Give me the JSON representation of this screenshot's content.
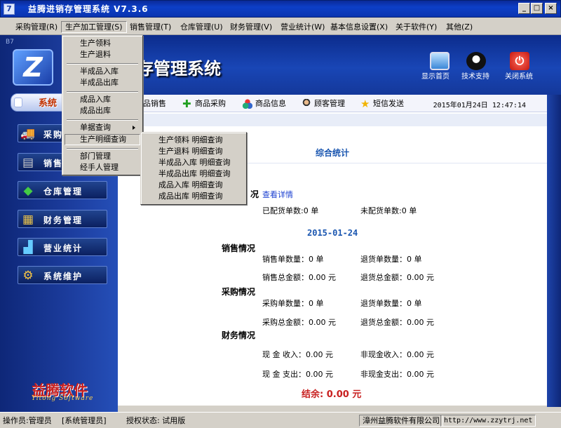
{
  "window": {
    "title": "益腾进销存管理系统  V7.3.6",
    "minimize_icon": "minimize-icon",
    "maximize_icon": "maximize-icon",
    "close_icon": "close-icon"
  },
  "menubar": {
    "items": [
      {
        "label": "采购管理(R)"
      },
      {
        "label": "生产加工管理(S)"
      },
      {
        "label": "销售管理(T)"
      },
      {
        "label": "仓库管理(U)"
      },
      {
        "label": "财务管理(V)"
      },
      {
        "label": "营业统计(W)"
      },
      {
        "label": "基本信息设置(X)"
      },
      {
        "label": "关于软件(Y)"
      },
      {
        "label": "其他(Z)"
      }
    ],
    "active_index": 1
  },
  "production_menu": {
    "items": [
      "生产领料",
      "生产退料",
      "半成品入库",
      "半成品出库",
      "成品入库",
      "成品出库",
      "单据查询",
      "生产明细查询",
      "部门管理",
      "经手人管理"
    ],
    "highlighted": "生产明细查询"
  },
  "detail_submenu": {
    "items": [
      "生产领料  明细查询",
      "生产退料  明细查询",
      "半成品入库  明细查询",
      "半成品出库  明细查询",
      "成品入库  明细查询",
      "成品出库  明细查询"
    ]
  },
  "banner": {
    "corner_code": "B7",
    "title_visible": "存管理系统",
    "buttons": [
      {
        "label": "显示首页",
        "icon": "monitor-icon"
      },
      {
        "label": "技术支持",
        "icon": "qq-penguin-icon"
      },
      {
        "label": "关闭系统",
        "icon": "power-icon"
      }
    ]
  },
  "nav_tab": {
    "label": "系统"
  },
  "toolbar": {
    "items": [
      {
        "label": "品销售",
        "icon": ""
      },
      {
        "label": "商品采购",
        "icon": "green-plus-icon"
      },
      {
        "label": "商品信息",
        "icon": "colored-balls-icon"
      },
      {
        "label": "顾客管理",
        "icon": "people-icon"
      },
      {
        "label": "短信发送",
        "icon": "star-icon"
      }
    ],
    "datetime": "2015年01月24日  12:47:14"
  },
  "sidebar": {
    "items": [
      {
        "label": "采购",
        "icon": "purchase-truck-icon"
      },
      {
        "label": "销售",
        "icon": "cash-register-icon"
      },
      {
        "label": "仓库管理",
        "icon": "warehouse-boxes-icon"
      },
      {
        "label": "财务管理",
        "icon": "money-icon"
      },
      {
        "label": "营业统计",
        "icon": "statistics-icon"
      },
      {
        "label": "系统维护",
        "icon": "gear-icon"
      }
    ],
    "brand": "益腾软件",
    "brand_sub": "Yitong Software"
  },
  "content": {
    "section_title": "综合统计",
    "delivery": {
      "heading_visible": "况",
      "link": "查看详情",
      "delivered": "已配货单数:0 单",
      "undelivered": "未配货单数:0 单"
    },
    "date": "2015-01-24",
    "sales": {
      "heading": "销售情况",
      "count": "销售单数量：0 单",
      "return_count": "退货单数量：0 单",
      "total": "销售总金额：0.00 元",
      "return_total": "退货总金额：0.00 元"
    },
    "purchase": {
      "heading": "采购情况",
      "count": "采购单数量：0 单",
      "return_count": "退货单数量：0 单",
      "total": "采购总金额：0.00 元",
      "return_total": "退货总金额：0.00 元"
    },
    "finance": {
      "heading": "财务情况",
      "cash_in": "现 金 收入：0.00 元",
      "noncash_in": "非现金收入：0.00 元",
      "cash_out": "现 金 支出：0.00 元",
      "noncash_out": "非现金支出：0.00 元"
    },
    "balance": "结余: 0.00 元"
  },
  "statusbar": {
    "operator": "操作员:管理员",
    "role": "[系统管理员]",
    "license": "授权状态: 试用版",
    "company": "漳州益腾软件有限公司",
    "url": "http://www.zzytrj.net"
  },
  "colors": {
    "title_blue": "#0d3fc7",
    "accent_blue": "#1a56b0",
    "balance_red": "#c82020"
  }
}
